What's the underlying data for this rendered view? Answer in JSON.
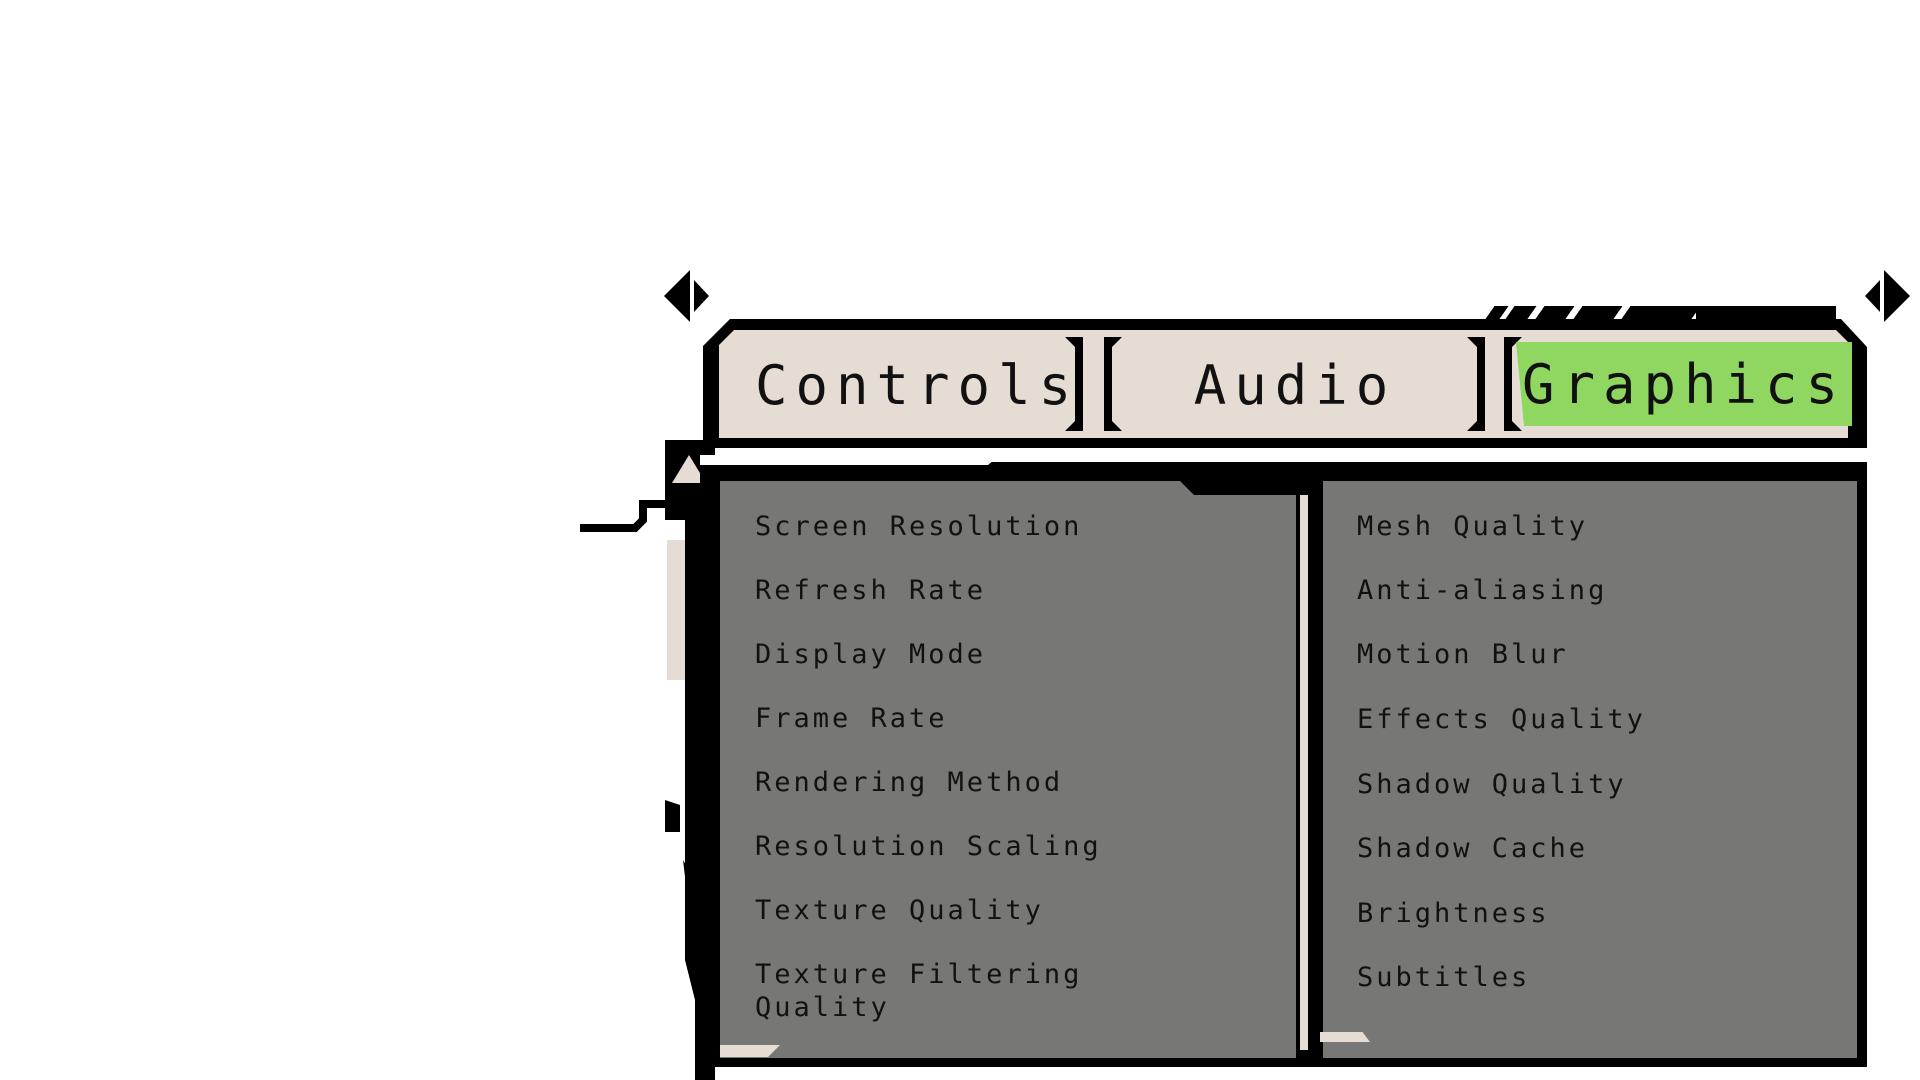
{
  "tabs": [
    {
      "id": "controls",
      "label": "Controls",
      "active": false
    },
    {
      "id": "audio",
      "label": "Audio",
      "active": false
    },
    {
      "id": "graphics",
      "label": "Graphics",
      "active": true
    }
  ],
  "colors": {
    "frame": "#000000",
    "tab_background": "#e5ddd3",
    "active_tab": "#8fd760",
    "panel": "#777776",
    "text": "#111111"
  },
  "left_settings": [
    "Screen Resolution",
    "Refresh Rate",
    "Display Mode",
    "Frame Rate",
    "Rendering Method",
    "Resolution Scaling",
    "Texture Quality",
    "Texture Filtering\nQuality"
  ],
  "right_settings": [
    "Mesh Quality",
    "Anti-aliasing",
    "Motion Blur",
    "Effects Quality",
    "Shadow Quality",
    "Shadow Cache",
    "Brightness",
    "Subtitles"
  ],
  "icons": {
    "prev": "arrow-left-icon",
    "next": "arrow-right-icon",
    "scroll_up": "triangle-up-icon"
  }
}
